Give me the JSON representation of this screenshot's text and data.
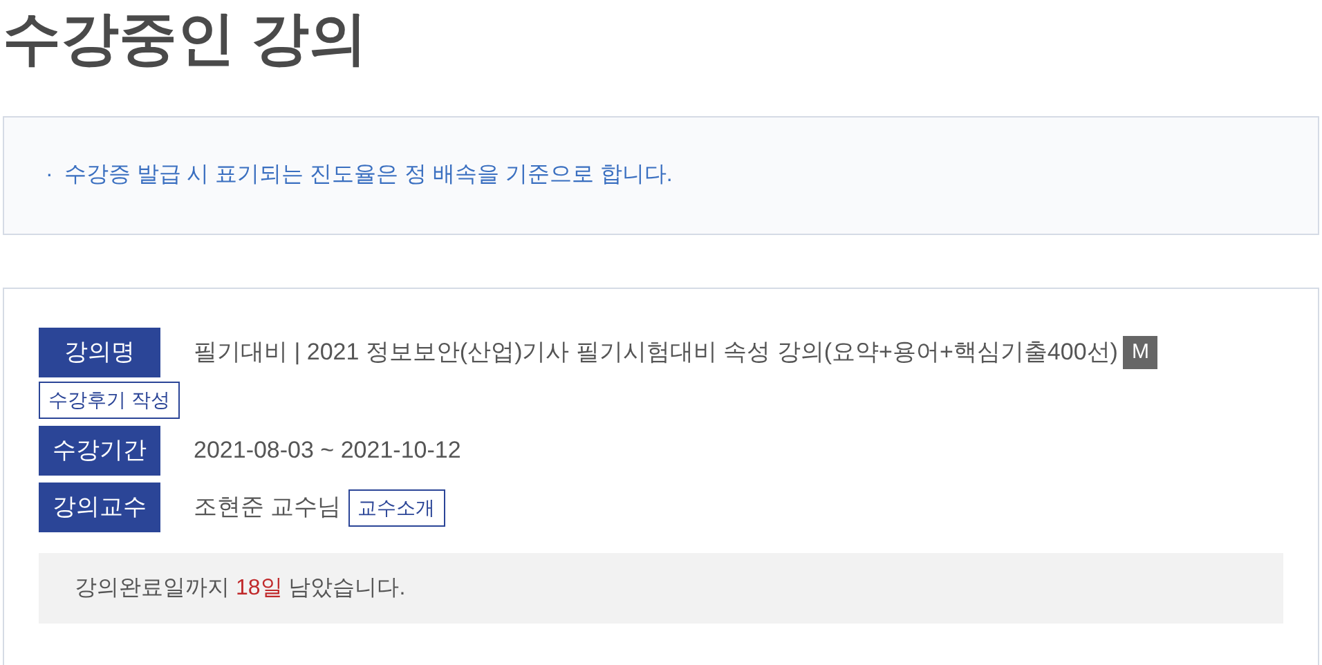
{
  "page_title": "수강중인 강의",
  "notice": {
    "bullet": "·",
    "text": "수강증 발급 시 표기되는 진도율은 정 배속을 기준으로 합니다."
  },
  "course": {
    "fields": [
      {
        "kind": "title",
        "label": "강의명",
        "value": "필기대비 | 2021 정보보안(산업)기사 필기시험대비 속성 강의(요약+용어+핵심기출400선)",
        "badge": "M",
        "button": "수강후기 작성"
      },
      {
        "kind": "plain",
        "label": "수강기간",
        "value": "2021-08-03 ~ 2021-10-12"
      },
      {
        "kind": "person",
        "label": "강의교수",
        "value": "조현준 교수님",
        "button": "교수소개"
      }
    ],
    "remaining": {
      "before": "강의완료일까지 ",
      "highlight": "18일",
      "after": " 남았습니다."
    }
  }
}
